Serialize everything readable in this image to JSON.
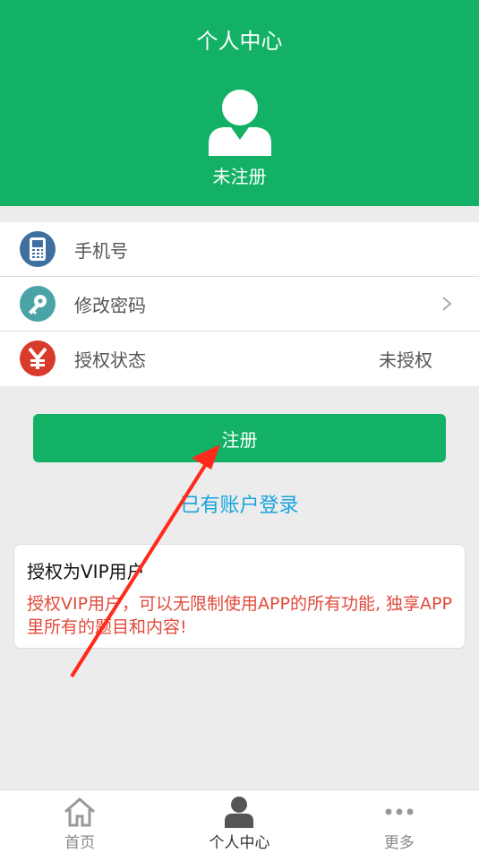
{
  "header": {
    "title": "个人中心",
    "status": "未注册"
  },
  "list": {
    "items": [
      {
        "label": "手机号",
        "value": "",
        "icon": "phone-icon",
        "color": "#3f6f9f"
      },
      {
        "label": "修改密码",
        "value": "",
        "icon": "key-icon",
        "color": "#4aa3a6"
      },
      {
        "label": "授权状态",
        "value": "未授权",
        "icon": "yen-icon",
        "color": "#d83a2b"
      }
    ]
  },
  "actions": {
    "register_label": "注册",
    "login_label": "已有账户登录"
  },
  "vip": {
    "title": "授权为VIP用户",
    "description": "授权VIP用户，可以无限制使用APP的所有功能, 独享APP里所有的题目和内容!"
  },
  "tabbar": {
    "tabs": [
      {
        "label": "首页",
        "icon": "home-icon"
      },
      {
        "label": "个人中心",
        "icon": "user-icon"
      },
      {
        "label": "更多",
        "icon": "more-icon"
      }
    ]
  },
  "colors": {
    "brand": "#13b166",
    "link": "#19a4dd",
    "warning_text": "#e04a3b"
  }
}
